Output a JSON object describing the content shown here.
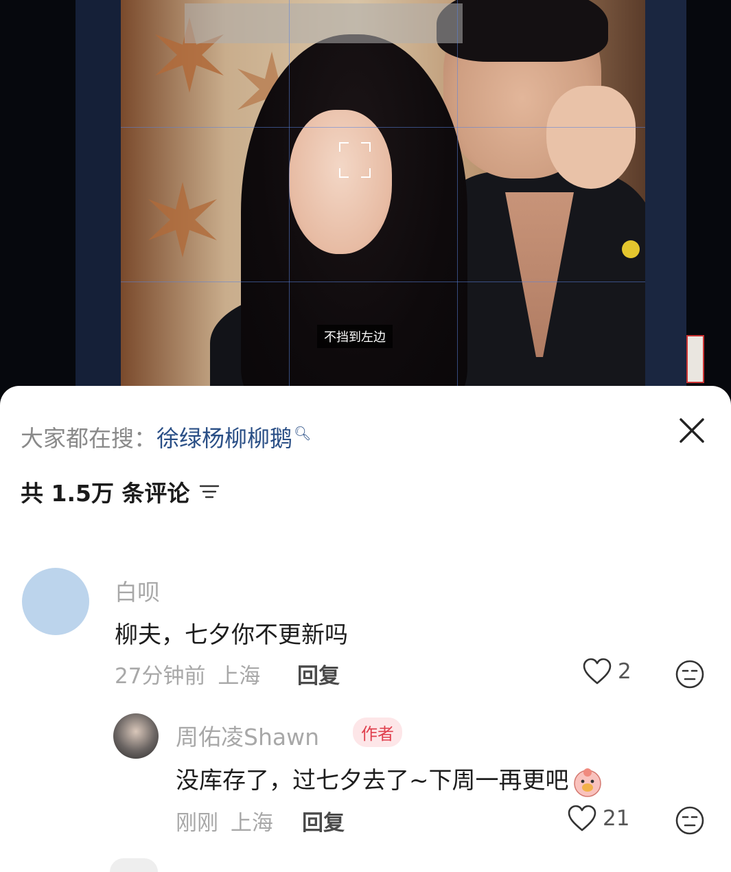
{
  "video": {
    "caption": "不挡到左边"
  },
  "sheet": {
    "search_prefix": "大家都在搜：",
    "search_term": "徐绿杨柳柳鹅",
    "comment_count_label": "共 1.5万 条评论"
  },
  "comments": [
    {
      "username": "白呗",
      "text": "柳夫，七夕你不更新吗",
      "time": "27分钟前",
      "location": "上海",
      "reply_label": "回复",
      "likes": "2"
    },
    {
      "username": "周佑凌Shawn",
      "badge": "作者",
      "text": "没库存了，过七夕去了~下周一再更吧",
      "time": "刚刚",
      "location": "上海",
      "reply_label": "回复",
      "likes": "21"
    }
  ],
  "colors": {
    "search_term": "#2a4f86",
    "author_badge_bg": "#fde6e8",
    "author_badge_text": "#e0404e"
  }
}
